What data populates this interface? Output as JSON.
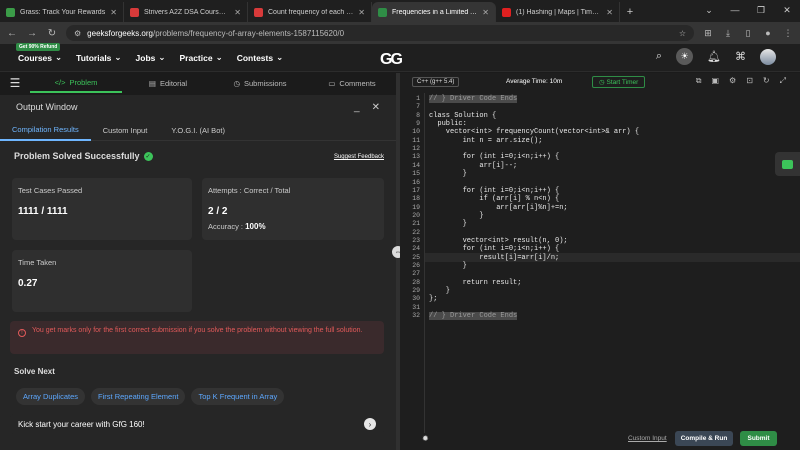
{
  "browser": {
    "tabs": [
      {
        "title": "Grass: Track Your Rewards",
        "fav": "#3b9c48"
      },
      {
        "title": "Strivers A2Z DSA Course/Sheet",
        "fav": "#d83a3a"
      },
      {
        "title": "Count frequency of each eleme",
        "fav": "#d83a3a"
      },
      {
        "title": "Frequencies in a Limited Array |",
        "fav": "#2f8d46",
        "active": true
      },
      {
        "title": "(1) Hashing | Maps | Time Comp",
        "fav": "#e02020"
      }
    ],
    "url_domain": "geeksforgeeks.org",
    "url_path": "/problems/frequency-of-array-elements-1587115620/0"
  },
  "gfg_nav": {
    "badge": "Get 90% Refund",
    "menu": [
      "Courses",
      "Tutorials",
      "Jobs",
      "Practice",
      "Contests"
    ],
    "logo": "GG"
  },
  "problem_tabs": [
    "Problem",
    "Editorial",
    "Submissions",
    "Comments"
  ],
  "output": {
    "title": "Output Window",
    "tabs": [
      "Compilation Results",
      "Custom Input",
      "Y.O.G.I. (AI Bot)"
    ],
    "status": "Problem Solved Successfully",
    "feedback": "Suggest Feedback",
    "tests_label": "Test Cases Passed",
    "tests_value": "1111 / 1111",
    "attempts_label": "Attempts : Correct / Total",
    "attempts_value": "2 / 2",
    "accuracy_label": "Accuracy :",
    "accuracy_value": "100%",
    "time_label": "Time Taken",
    "time_value": "0.27",
    "warning": "You get marks only for the first correct submission if you solve the problem without viewing the full solution.",
    "solve_next": "Solve Next",
    "chips": [
      "Array Duplicates",
      "First Repeating Element",
      "Top K Frequent in Array"
    ],
    "kickstart": "Kick start your career with GfG 160!"
  },
  "editor": {
    "language": "C++ (g++ 5.4)",
    "avg_time": "Average Time: 10m",
    "start_timer": "Start Timer",
    "custom_input": "Custom Input",
    "compile": "Compile & Run",
    "submit": "Submit",
    "line_numbers": [
      "1",
      "7",
      "8",
      "9",
      "10",
      "11",
      "12",
      "13",
      "14",
      "15",
      "16",
      "17",
      "18",
      "19",
      "20",
      "21",
      "22",
      "23",
      "24",
      "25",
      "26",
      "27",
      "28",
      "29",
      "30",
      "31",
      "32"
    ],
    "lines": [
      "// } Driver Code Ends",
      "",
      "class Solution {",
      "  public:",
      "    vector<int> frequencyCount(vector<int>& arr) {",
      "        int n = arr.size();",
      "",
      "        for (int i=0;i<n;i++) {",
      "            arr[i]--;",
      "        }",
      "",
      "        for (int i=0;i<n;i++) {",
      "            if (arr[i] % n<n) {",
      "                arr[arr[i]%n]+=n;",
      "            }",
      "        }",
      "",
      "        vector<int> result(n, 0);",
      "        for (int i=0;i<n;i++) {",
      "            result[i]=arr[i]/n;",
      "        }",
      "",
      "        return result;",
      "    }",
      "};",
      "",
      "// } Driver Code Ends"
    ]
  }
}
